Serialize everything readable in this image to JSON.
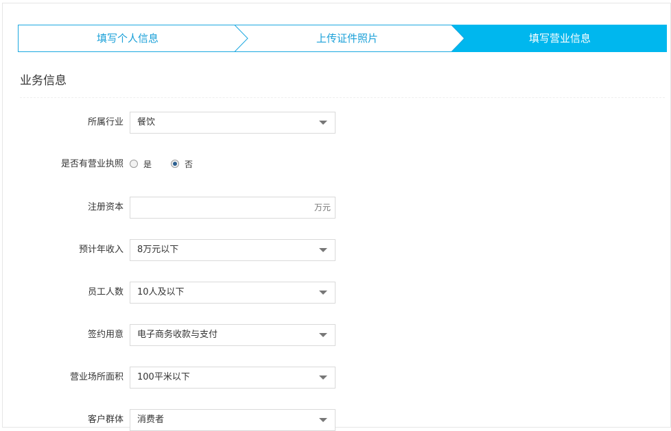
{
  "steps": [
    {
      "label": "填写个人信息"
    },
    {
      "label": "上传证件照片"
    },
    {
      "label": "填写营业信息"
    }
  ],
  "colors": {
    "accent": "#00b7ee",
    "accent_text": "#1aa0d8"
  },
  "section": {
    "title": "业务信息"
  },
  "form": {
    "industry": {
      "label": "所属行业",
      "value": "餐饮"
    },
    "license": {
      "label": "是否有营业执照",
      "options": [
        {
          "label": "是",
          "checked": false
        },
        {
          "label": "否",
          "checked": true
        }
      ]
    },
    "capital": {
      "label": "注册资本",
      "value": "",
      "suffix": "万元"
    },
    "income": {
      "label": "预计年收入",
      "value": "8万元以下"
    },
    "employees": {
      "label": "员工人数",
      "value": "10人及以下"
    },
    "purpose": {
      "label": "签约用意",
      "value": "电子商务收款与支付"
    },
    "area": {
      "label": "营业场所面积",
      "value": "100平米以下"
    },
    "customers": {
      "label": "客户群体",
      "value": "消费者"
    }
  }
}
